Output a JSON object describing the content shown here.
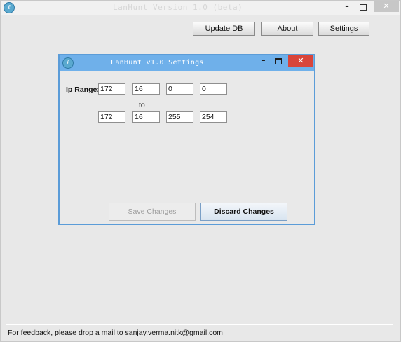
{
  "main_window": {
    "title": "LanHunt Version 1.0 (beta)",
    "controls": {
      "minimize": "-",
      "close": "✕"
    }
  },
  "toolbar": {
    "update_db": "Update DB",
    "about": "About",
    "settings": "Settings"
  },
  "footer": {
    "text": "For feedback, please drop a mail to sanjay.verma.nitk@gmail.com"
  },
  "dialog": {
    "title": "LanHunt v1.0 Settings",
    "controls": {
      "minimize": "-",
      "close": "✕"
    },
    "ip_range_label": "Ip Range:",
    "to_label": "to",
    "start_ip": [
      "172",
      "16",
      "0",
      "0"
    ],
    "end_ip": [
      "172",
      "16",
      "255",
      "254"
    ],
    "save_changes": "Save Changes",
    "discard_changes": "Discard Changes"
  },
  "colors": {
    "dialog_titlebar": "#6fb0ea",
    "dialog_border": "#5b9cd8",
    "close_button": "#d9453b",
    "window_background": "#e8e8e8"
  }
}
